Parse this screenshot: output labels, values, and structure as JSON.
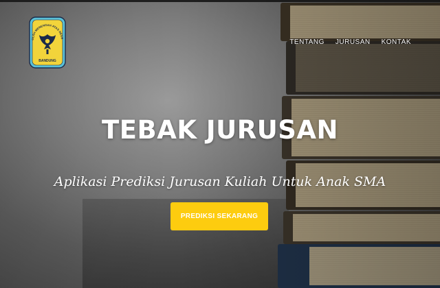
{
  "logo": {
    "ring_text": "SEKOLAH MENENGAH ATAS NEGERI 10",
    "bottom_text": "BANDUNG",
    "colors": {
      "outer": "#5bc0d6",
      "inner": "#f2d43b",
      "emblem": "#1b2a4a"
    }
  },
  "nav": {
    "items": [
      {
        "label": "TENTANG"
      },
      {
        "label": "JURUSAN"
      },
      {
        "label": "KONTAK"
      }
    ]
  },
  "hero": {
    "title": "TEBAK JURUSAN",
    "subtitle": "Aplikasi Prediksi Jurusan Kuliah Untuk Anak SMA",
    "cta_label": "PREDIKSI SEKARANG"
  },
  "colors": {
    "accent": "#fdcc0f",
    "text": "#ffffff"
  }
}
